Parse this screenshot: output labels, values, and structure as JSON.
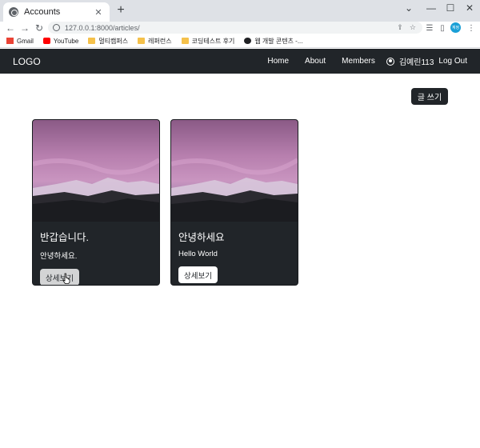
{
  "browser": {
    "tab_title": "Accounts",
    "url": "127.0.0.1:8000/articles/",
    "profile_label": "계정",
    "bookmarks": [
      {
        "label": "Gmail",
        "icon": "gmail-icon"
      },
      {
        "label": "YouTube",
        "icon": "youtube-icon"
      },
      {
        "label": "멀티캠퍼스",
        "icon": "folder-icon"
      },
      {
        "label": "레퍼런스",
        "icon": "folder-icon"
      },
      {
        "label": "코딩테스트 후기",
        "icon": "folder-icon"
      },
      {
        "label": "웹 개발 콘텐츠 -...",
        "icon": "site-icon"
      }
    ]
  },
  "navbar": {
    "logo": "LOGO",
    "links": [
      "Home",
      "About",
      "Members"
    ],
    "username": "김예린113",
    "logout": "Log Out"
  },
  "write_button": "글 쓰기",
  "articles": [
    {
      "title": "반갑습니다.",
      "text": "안녕하세요.",
      "button": "상세보기"
    },
    {
      "title": "안녕하세요",
      "text": "Hello World",
      "button": "상세보기"
    }
  ],
  "colors": {
    "navbar": "#212529",
    "card": "#212529"
  }
}
